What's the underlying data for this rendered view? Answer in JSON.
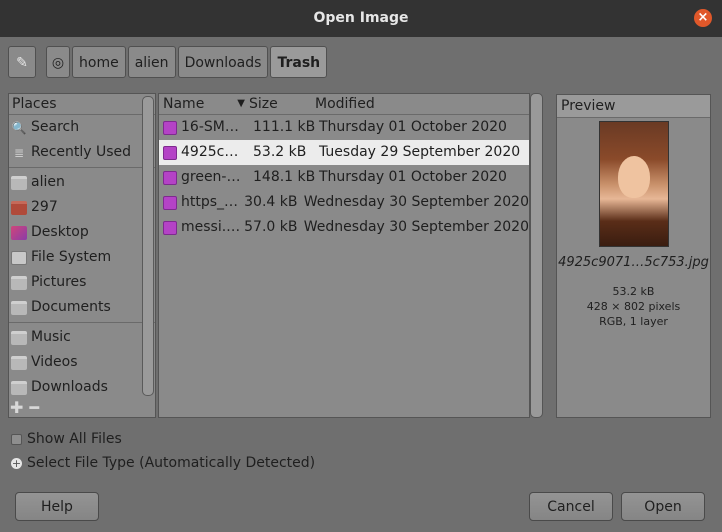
{
  "window": {
    "title": "Open Image",
    "close_glyph": "×"
  },
  "pathbar": {
    "segments": [
      "home",
      "alien",
      "Downloads",
      "Trash"
    ],
    "active": "Trash"
  },
  "places": {
    "header": "Places",
    "items": [
      {
        "label": "Search",
        "icon": "search-icon"
      },
      {
        "label": "Recently Used",
        "icon": "recent-icon"
      },
      {
        "label": "alien",
        "icon": "folder-icon"
      },
      {
        "label": "297",
        "icon": "folder-icon"
      },
      {
        "label": "Desktop",
        "icon": "desktop-icon"
      },
      {
        "label": "File System",
        "icon": "drive-icon"
      },
      {
        "label": "Pictures",
        "icon": "folder-icon"
      },
      {
        "label": "Documents",
        "icon": "folder-icon"
      },
      {
        "label": "Music",
        "icon": "folder-icon"
      },
      {
        "label": "Videos",
        "icon": "folder-icon"
      },
      {
        "label": "Downloads",
        "icon": "folder-icon"
      }
    ]
  },
  "files": {
    "columns": {
      "name": "Name",
      "size": "Size",
      "modified": "Modified"
    },
    "rows": [
      {
        "name": "16-SM…",
        "size": "111.1 kB",
        "modified": "Thursday 01 October 2020"
      },
      {
        "name": "4925c…",
        "size": "53.2 kB",
        "modified": "Tuesday 29 September 2020"
      },
      {
        "name": "green-…",
        "size": "148.1 kB",
        "modified": "Thursday 01 October 2020"
      },
      {
        "name": "https_…",
        "size": "30.4 kB",
        "modified": "Wednesday 30 September 2020"
      },
      {
        "name": "messi.…",
        "size": "57.0 kB",
        "modified": "Wednesday 30 September 2020"
      }
    ],
    "selected_index": 1
  },
  "preview": {
    "header": "Preview",
    "filename": "4925c9071…5c753.jpg",
    "size": "53.2 kB",
    "dimensions": "428 × 802 pixels",
    "info": "RGB, 1 layer"
  },
  "options": {
    "show_all_files": "Show All Files",
    "select_file_type": "Select File Type (Automatically Detected)"
  },
  "buttons": {
    "help": "Help",
    "cancel": "Cancel",
    "open": "Open"
  },
  "colors": {
    "accent_close": "#e0582a",
    "selection": "#ececec",
    "image_icon": "#b443c6"
  }
}
